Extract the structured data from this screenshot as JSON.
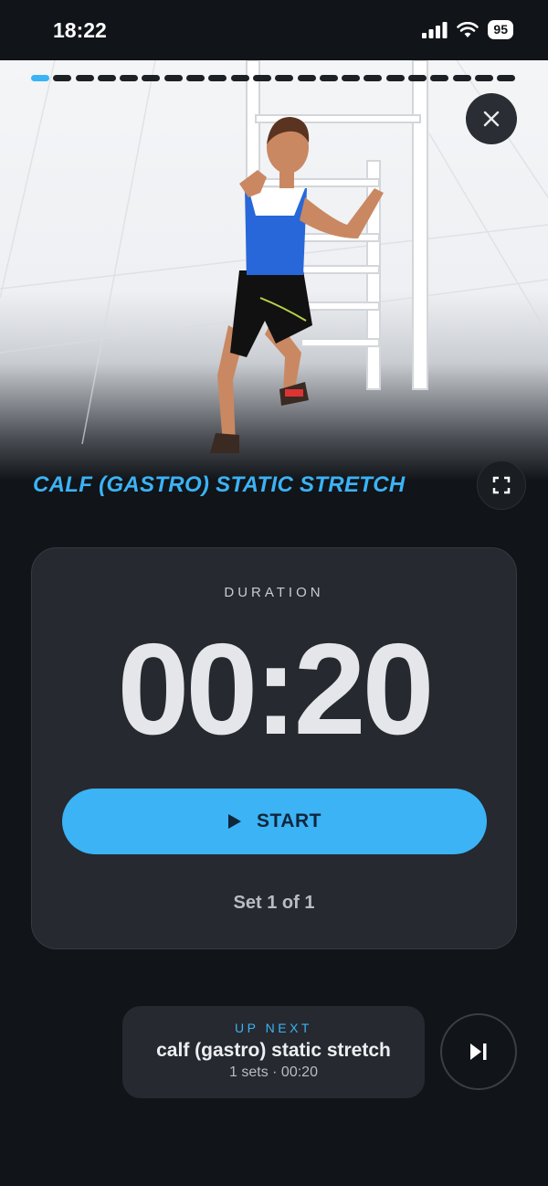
{
  "status_bar": {
    "time": "18:22",
    "battery": "95"
  },
  "hero": {
    "progress_total": 22,
    "progress_current": 1,
    "image": "3D figure stretching calf against white wall ladder"
  },
  "exercise": {
    "title": "CALF (GASTRO) STATIC STRETCH"
  },
  "timer_card": {
    "duration_label": "DURATION",
    "time": "00:20",
    "start_label": "START",
    "set_text": "Set 1 of 1"
  },
  "up_next": {
    "label": "UP NEXT",
    "title": "calf (gastro) static stretch",
    "meta": "1 sets · 00:20"
  },
  "colors": {
    "accent": "#3bb3f5",
    "background": "#111418",
    "card": "#26292f"
  },
  "icons": {
    "close": "close-icon",
    "fullscreen": "fullscreen-icon",
    "play": "play-icon",
    "skip": "skip-next-icon"
  }
}
